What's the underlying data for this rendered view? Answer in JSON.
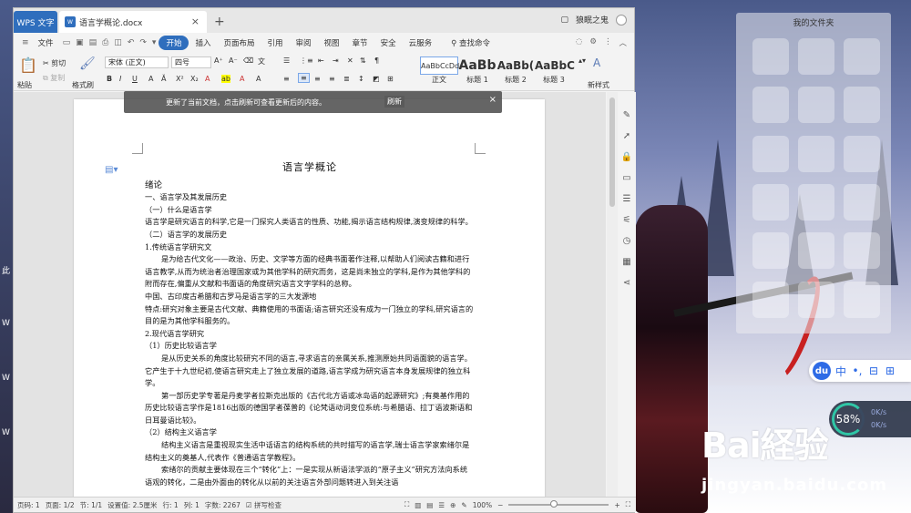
{
  "window": {
    "app_tab": "WPS 文字",
    "doc_tab": "语言学概论.docx",
    "doc_icon_label": "W",
    "user_name": "狼眠之鬼"
  },
  "menu": {
    "file": "文件",
    "items": [
      "开始",
      "插入",
      "页面布局",
      "引用",
      "审阅",
      "视图",
      "章节",
      "安全",
      "云服务"
    ],
    "active": "开始",
    "search": "查找命令"
  },
  "ribbon": {
    "paste": "粘贴",
    "cut": "剪切",
    "copy": "复制",
    "format_painter": "格式刷",
    "font_name": "宋体 (正文)",
    "font_size": "四号",
    "styles": [
      {
        "preview": "AaBbCcDd",
        "label": "正文"
      },
      {
        "preview": "AaBb",
        "label": "标题 1"
      },
      {
        "preview": "AaBb(",
        "label": "标题 2"
      },
      {
        "preview": "AaBbC",
        "label": "标题 3"
      }
    ],
    "new_style": "新样式"
  },
  "notification": {
    "text": "更新了当前文档，点击刷新可查看更新后的内容。",
    "refresh": "刷新"
  },
  "document": {
    "title": "语言学概论",
    "lines": [
      {
        "t": "绪论",
        "c": "h"
      },
      {
        "t": "一、语言学及其发展历史",
        "c": ""
      },
      {
        "t": "（一）什么是语言学",
        "c": ""
      },
      {
        "t": "语言学是研究语言的科学,它是一门探究人类语言的性质、功能,揭示语言结构规律,演变规律的科学。",
        "c": ""
      },
      {
        "t": "（二）语言学的发展历史",
        "c": ""
      },
      {
        "t": "1.传统语言学研究文",
        "c": ""
      },
      {
        "t": "是为给古代文化——政治、历史、文学等方面的经典书面著作注释,以帮助人们阅读古籍和进行语言教学,从而为统治者治理国家或为其他学科的研究而务，这是尚未独立的学科,是作为其他学科的附而存在,偏重从文献和书面语的角度研究语言文字学科的总称。",
        "c": "ind"
      },
      {
        "t": "中国、古印度古希腊和古罗马是语言学的三大发源地",
        "c": ""
      },
      {
        "t": "特点:研究对象主要是古代文献、典籍使用的书面语;语言研究还没有成为一门独立的学科,研究语言的目的是为其他学科服务的。",
        "c": ""
      },
      {
        "t": "2.现代语言学研究",
        "c": ""
      },
      {
        "t": "（1）历史比较语言学",
        "c": ""
      },
      {
        "t": "是从历史关系的角度比较研究不同的语言,寻求语言的亲属关系,推测原始共同语面貌的语言学。它产生于十九世纪初,使语言研究走上了独立发展的道路,语言学成为研究语言本身发展规律的独立科学。",
        "c": "ind"
      },
      {
        "t": "第一部历史学专著是丹麦学者拉斯克出版的《古代北方语或冰岛语的起源研究》;有奠基作用的历史比较语言学作是1816出版的德国学者葆普的《论梵语动词变位系统:与希腊语、拉丁语波斯语和日耳曼语比较》。",
        "c": "ind"
      },
      {
        "t": "（2）结构主义语言学",
        "c": ""
      },
      {
        "t": "结构主义语言是重视现实生活中话语言的结构系统的共时描写的语言学,瑞士语言学家索绪尔是结构主义的奠基人,代表作《普通语言学教程》。",
        "c": "ind"
      },
      {
        "t": "索绪尔的贡献主要体现在三个“转化”上：一是实现从新语法学派的“原子主义”研究方法向系统语观的转化，二是由外面由的转化从以前的关注语言外部问题转进入到关注语",
        "c": "ind"
      }
    ]
  },
  "status": {
    "page_num": "页码: 1",
    "pages": "页面: 1/2",
    "section": "节: 1/1",
    "setting": "设置值: 2.5厘米",
    "row": "行: 1",
    "col": "列: 1",
    "words": "字数: 2267",
    "spellcheck": "拼写检查",
    "zoom": "100%",
    "zoom_fraction": 0.45
  },
  "desktop": {
    "folder_title": "我的文件夹",
    "meter_percent": "58%",
    "meter_line1": "0K/s",
    "meter_line2": "0K/s",
    "du_logo": "du",
    "du_icons": [
      "中",
      "•,",
      "⊟",
      "⊞"
    ],
    "watermark_main": "Bai経验",
    "watermark_url": "jingyan.baidu.com",
    "left_chars": [
      "此",
      "W",
      "W",
      "W"
    ]
  }
}
